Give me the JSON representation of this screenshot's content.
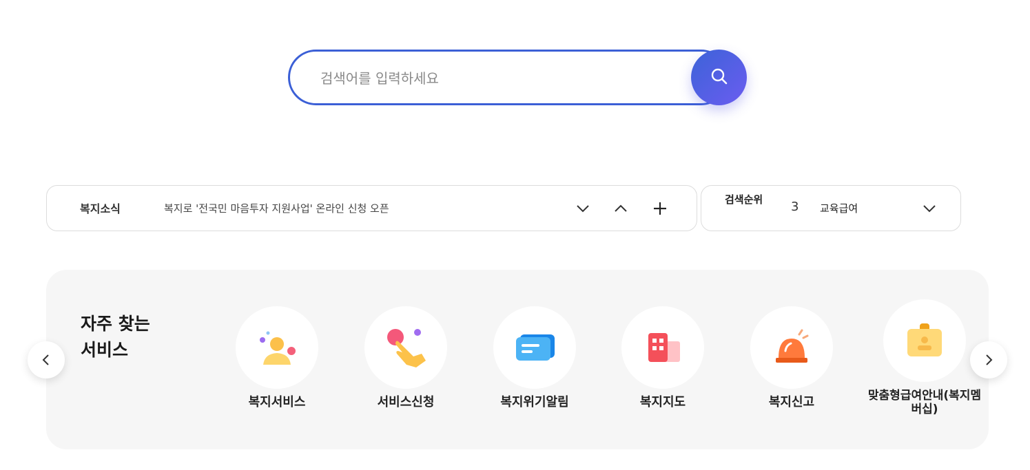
{
  "search": {
    "placeholder": "검색어를 입력하세요",
    "button_icon": "search-icon"
  },
  "news": {
    "label": "복지소식",
    "headline": "복지로 '전국민 마음투자 지원사업' 온라인 신청 오픈",
    "controls": [
      "chevron-down-icon",
      "chevron-up-icon",
      "plus-icon"
    ]
  },
  "ranking": {
    "label": "검색순위",
    "rank": "3",
    "keyword": "교육급여",
    "toggle_icon": "chevron-down-icon"
  },
  "services": {
    "title": "자주 찾는 서비스",
    "items": [
      {
        "label": "복지서비스",
        "icon": "person-icon"
      },
      {
        "label": "서비스신청",
        "icon": "hand-tap-icon"
      },
      {
        "label": "복지위기알림",
        "icon": "message-icon"
      },
      {
        "label": "복지지도",
        "icon": "building-icon"
      },
      {
        "label": "복지신고",
        "icon": "siren-icon"
      },
      {
        "label": "맞춤형급여안내(복지멤버십)",
        "icon": "id-badge-icon"
      }
    ],
    "prev_icon": "chevron-left-icon",
    "next_icon": "chevron-right-icon"
  },
  "colors": {
    "accent": "#3b5fd6",
    "accent_gradient_end": "#6b5cf0",
    "panel_bg": "#f6f6f6"
  }
}
